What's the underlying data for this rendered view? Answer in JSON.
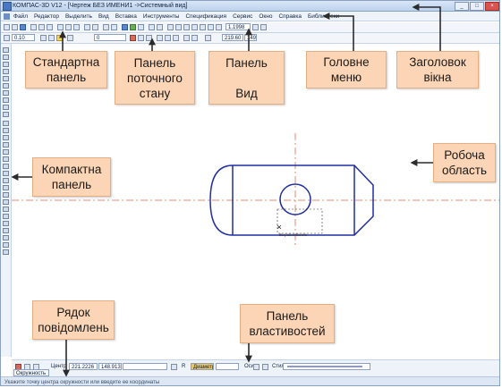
{
  "window": {
    "title": "КОМПАС-3D V12 - [Чертеж БЕЗ ИМЕНИ1 ->Системный вид]",
    "buttons": [
      "_",
      "□",
      "×"
    ]
  },
  "menu": [
    "Файл",
    "Редактор",
    "Выделить",
    "Вид",
    "Вставка",
    "Инструменты",
    "Спецификация",
    "Сервис",
    "Окно",
    "Справка",
    "Библиотеки"
  ],
  "toolbar_row1": {
    "zoom_value": "1.1998"
  },
  "toolbar_row2": {
    "style_value": "0.10",
    "layer_value": "0",
    "step_value": "219.60",
    "step2_value": "149"
  },
  "drawing": {
    "hole_label": "Выравнивание"
  },
  "property_panel": {
    "center_label": "Центр",
    "center_x": "221.2226",
    "center_y": "148.913",
    "radius_label": "R",
    "diameter_label": "Диаметр",
    "axes_label": "Оси",
    "style_label": "Стиль",
    "tab_label": "Окружность"
  },
  "status_bar": {
    "message": "Укажите точку центра окружности или введите ее координаты"
  },
  "callouts": {
    "standard_panel": "Стандартна\nпанель",
    "state_panel": "Панель\nпоточного\nстану",
    "view_panel": "Панель\n\nВид",
    "main_menu": "Головне\nменю",
    "window_title": "Заголовок\nвікна",
    "compact_panel": "Компактна\nпанель",
    "work_area": "Робоча\nобласть",
    "message_row": "Рядок\nповідомлень",
    "properties_panel": "Панель\nвластивостей"
  },
  "colors": {
    "callout_fill": "#fbd5b5",
    "drawing_line": "#1f2fa0",
    "axis_line": "#e06a4a",
    "arrow": "#2b2b2b"
  }
}
